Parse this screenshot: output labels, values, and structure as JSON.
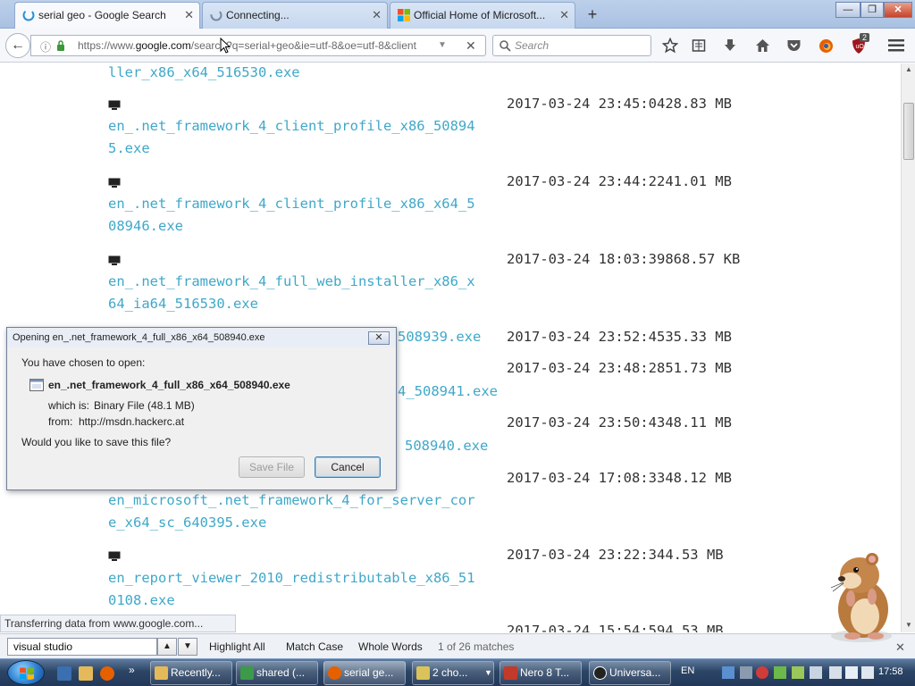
{
  "tabs": [
    {
      "title": "serial geo - Google Search",
      "active": true
    },
    {
      "title": "Connecting...",
      "active": false
    },
    {
      "title": "Official Home of Microsoft...",
      "active": false
    }
  ],
  "window_controls": {
    "minimize": "—",
    "maximize": "❐",
    "close": "✕"
  },
  "navbar": {
    "url_prefix": "https://www.",
    "url_domain": "google.com",
    "url_rest": "/search?q=serial+geo&ie=utf-8&oe=utf-8&client",
    "search_placeholder": "Search",
    "addon_badge": "2"
  },
  "files": [
    {
      "name_lines": [
        "ller_x86_x64_516530.exe"
      ],
      "date": "",
      "size": ""
    },
    {
      "name_lines": [
        "en_.net_framework_4_client_profile_x86_50894",
        "5.exe"
      ],
      "date": "2017-03-24 23:45:04",
      "size": "28.83 MB"
    },
    {
      "name_lines": [
        "en_.net_framework_4_client_profile_x86_x64_5",
        "08946.exe"
      ],
      "date": "2017-03-24 23:44:22",
      "size": "41.01 MB"
    },
    {
      "name_lines": [
        "en_.net_framework_4_full_web_installer_x86_x",
        "64_ia64_516530.exe"
      ],
      "date": "2017-03-24 18:03:39",
      "size": "868.57 KB"
    },
    {
      "name_lines": [
        "508939.exe"
      ],
      "date": "2017-03-24 23:52:45",
      "size": "35.33 MB"
    },
    {
      "name_lines": [
        "4_508941.exe"
      ],
      "date": "2017-03-24 23:48:28",
      "size": "51.73 MB"
    },
    {
      "name_lines": [
        "508940.exe"
      ],
      "date": "2017-03-24 23:50:43",
      "size": "48.11 MB"
    },
    {
      "name_lines": [
        "en_microsoft_.net_framework_4_for_server_cor",
        "e_x64_sc_640395.exe"
      ],
      "date": "2017-03-24 17:08:33",
      "size": "48.12 MB"
    },
    {
      "name_lines": [
        "en_report_viewer_2010_redistributable_x86_51",
        "0108.exe"
      ],
      "date": "2017-03-24 23:22:34",
      "size": "4.53 MB"
    },
    {
      "name_lines": [],
      "date": "2017-03-24 15:54:59",
      "size": "4.53 MB"
    }
  ],
  "status_text": "Transferring data from www.google.com...",
  "dialog": {
    "title": "Opening en_.net_framework_4_full_x86_x64_508940.exe",
    "chosen": "You have chosen to open:",
    "filename": "en_.net_framework_4_full_x86_x64_508940.exe",
    "which_is_label": "which is:",
    "which_is_value": "Binary File (48.1 MB)",
    "from_label": "from:",
    "from_value": "http://msdn.hackerc.at",
    "question": "Would you like to save this file?",
    "save_label": "Save File",
    "cancel_label": "Cancel"
  },
  "findbar": {
    "query": "visual studio",
    "highlight_all": "Highlight All",
    "match_case": "Match Case",
    "whole_words": "Whole Words",
    "matches": "1 of 26 matches"
  },
  "taskbar": {
    "tasks": [
      {
        "label": "Recently...",
        "active": false
      },
      {
        "label": "shared (...",
        "active": false
      },
      {
        "label": "serial ge...",
        "active": true
      },
      {
        "label": "2 cho...",
        "active": false
      },
      {
        "label": "Nero 8 T...",
        "active": false
      },
      {
        "label": "Universa...",
        "active": false
      }
    ],
    "language": "EN",
    "clock": "17:58"
  },
  "colors": {
    "link": "#3fa8c9",
    "accent": "#2f7fd0"
  }
}
